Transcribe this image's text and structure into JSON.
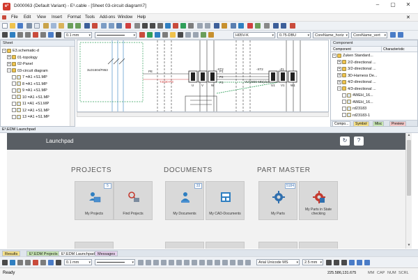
{
  "window": {
    "title": "D000063 (Default Variant) - E³.cable - [Sheet 03-circuit diagram\\7]",
    "app_icon_text": "e³"
  },
  "menu": [
    "File",
    "Edit",
    "View",
    "Insert",
    "Format",
    "Tools",
    "Add-ons",
    "Window",
    "Help"
  ],
  "toolbar": {
    "line_width": "0.1 mm",
    "wire_type": "H05V-K",
    "cross_section": "0.75-DBU",
    "core_name_horiz": "CoreName_horiz",
    "core_name_vert": "CoreName_vert"
  },
  "sheet_panel": {
    "title": "Sheet",
    "items": [
      {
        "label": "E3.schematic-d",
        "level": 0,
        "expander": "−"
      },
      {
        "label": "01-topology",
        "level": 1,
        "expander": "+"
      },
      {
        "label": "02-Panel",
        "level": 1,
        "expander": "+"
      },
      {
        "label": "03-circuit diagram",
        "level": 1,
        "expander": "−"
      },
      {
        "label": "7 =A1 +S1.MP",
        "level": 2,
        "expander": ""
      },
      {
        "label": "8 =A1 +S1.MP",
        "level": 2,
        "expander": ""
      },
      {
        "label": "9 =A1 +S1.MP",
        "level": 2,
        "expander": ""
      },
      {
        "label": "10 =A1 +S1.MP",
        "level": 2,
        "expander": ""
      },
      {
        "label": "11 =A1 +S1.MP",
        "level": 2,
        "expander": ""
      },
      {
        "label": "12 =A1 +S1.MP",
        "level": 2,
        "expander": ""
      },
      {
        "label": "13 =A1 +S1.MP",
        "level": 2,
        "expander": ""
      }
    ]
  },
  "component_panel": {
    "title": "Component",
    "columns": [
      "Component",
      "Characteristic"
    ],
    "items": [
      {
        "label": "Zuken Standard...",
        "level": 0,
        "expander": "−"
      },
      {
        "label": "2/2-directional ...",
        "level": 1,
        "expander": "+"
      },
      {
        "label": "3/2-directional ...",
        "level": 1,
        "expander": "+"
      },
      {
        "label": "3D-Harness De...",
        "level": 1,
        "expander": "+"
      },
      {
        "label": "4/2-directional ...",
        "level": 1,
        "expander": "+"
      },
      {
        "label": "4/3-directional ...",
        "level": 1,
        "expander": "−"
      },
      {
        "label": "4WEH_16...",
        "level": 2,
        "expander": ""
      },
      {
        "label": "4WEH_16...",
        "level": 2,
        "expander": ""
      },
      {
        "label": "rd23183",
        "level": 2,
        "expander": ""
      },
      {
        "label": "rd23183-1",
        "level": 2,
        "expander": ""
      },
      {
        "label": "rd23183-2",
        "level": 2,
        "expander": ""
      },
      {
        "label": "rd23183-3",
        "level": 2,
        "expander": ""
      }
    ],
    "tabs": [
      "Compo...",
      "Symbol",
      "Misc",
      "Preview"
    ]
  },
  "schematic": {
    "labels": {
      "ref_main": "3LD1504/F863",
      "ref_xt": "-XT2",
      "ref_xt2": "-XT2",
      "ref_z": "-Z1",
      "mid_label": "T2830-P8",
      "right_label": "VLT2800-MB/plus",
      "p_u": "U",
      "p_v": "V",
      "p_w": "W",
      "pe": "PE",
      "p1": "P1",
      "p2": "P2",
      "p3": "P3",
      "n_u1": "U1",
      "n_v1": "V1",
      "n_w1": "W1"
    }
  },
  "launchpad_window": {
    "tab_title": "E³.EDM Launchpad",
    "header_title": "Launchpad",
    "refresh_icon": "↻",
    "help_icon": "?",
    "sections": [
      {
        "title": "PROJECTS",
        "tiles": [
          {
            "label": "My Projects",
            "count": "5",
            "icon": "user-folder-icon"
          },
          {
            "label": "Find Projects",
            "count": "",
            "icon": "search-folder-icon"
          }
        ]
      },
      {
        "title": "DOCUMENTS",
        "tiles": [
          {
            "label": "My Documents",
            "count": "33",
            "icon": "user-document-icon"
          },
          {
            "label": "My CAD-Documents",
            "count": "",
            "icon": "cad-document-icon"
          }
        ]
      },
      {
        "title": "PART MASTER",
        "tiles": [
          {
            "label": "My Parts",
            "count": "5184",
            "icon": "gear-icon"
          },
          {
            "label": "My Parts in State checking",
            "count": "",
            "icon": "gear-check-icon"
          }
        ]
      }
    ]
  },
  "bottom_tabs": [
    "Results",
    "E³.EDM Projects",
    "E³.EDM Launchpad",
    "Messages"
  ],
  "bottom_toolbar": {
    "line_width": "0.1 mm",
    "font": "Arial Unicode MS",
    "font_size": "2.5 mm"
  },
  "status": {
    "left": "Ready",
    "coords": "225.586,131.675",
    "unit": "MM",
    "caps": "CAP",
    "num": "NUM",
    "scrl": "SCRL"
  },
  "colors": {
    "accent": "#2f7fc1",
    "red_accent": "#d23a2d",
    "header_gray": "#595e64",
    "tile_gray": "#d9d9d9"
  }
}
